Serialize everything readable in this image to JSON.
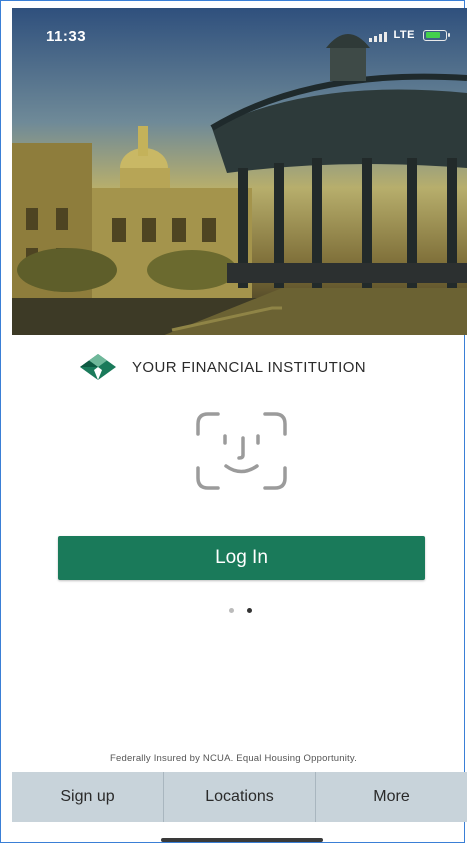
{
  "status": {
    "time": "11:33",
    "network": "LTE"
  },
  "brand": {
    "name": "YOUR FINANCIAL INSTITUTION",
    "logo_icon": "diamond-leaf-logo",
    "accent": "#1a7a5a"
  },
  "faceid": {
    "icon": "face-id-icon"
  },
  "login": {
    "label": "Log In"
  },
  "pager": {
    "pages": 2,
    "active_index": 1
  },
  "footnote": "Federally Insured by NCUA. Equal Housing Opportunity.",
  "tabs": [
    {
      "label": "Sign up"
    },
    {
      "label": "Locations"
    },
    {
      "label": "More"
    }
  ]
}
